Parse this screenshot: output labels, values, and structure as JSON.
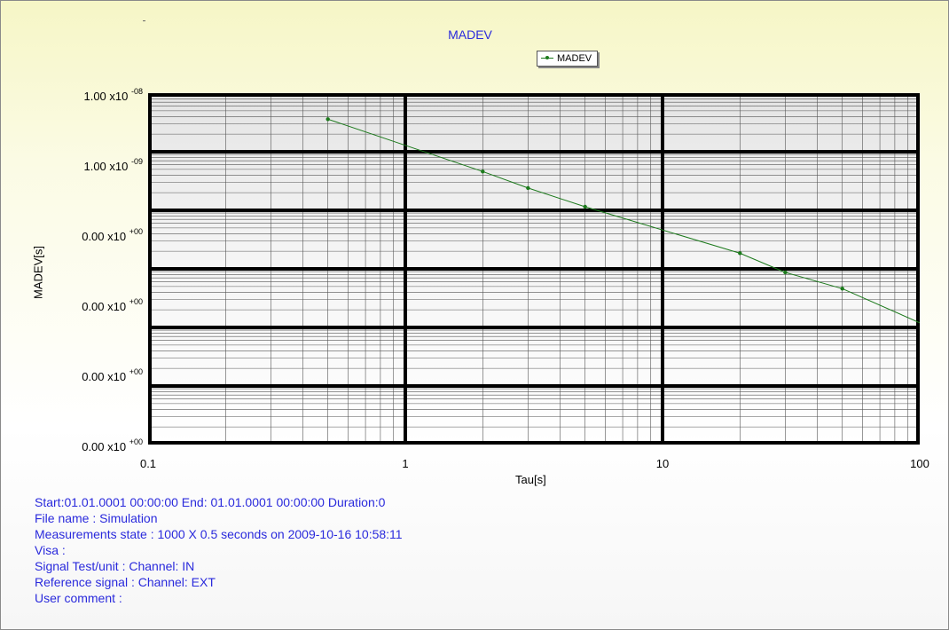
{
  "chart_data": {
    "type": "line",
    "title": "MADEV",
    "xlabel": "Tau[s]",
    "ylabel": "MADEV[s]",
    "x_scale": "log",
    "xlim": [
      0.1,
      100
    ],
    "x_ticks": [
      "0.1",
      "1",
      "10",
      "100"
    ],
    "y_scale": "log",
    "y_tick_labels": [
      {
        "mantissa": "1.00 x10",
        "exp": "-08"
      },
      {
        "mantissa": "1.00 x10",
        "exp": "-09"
      },
      {
        "mantissa": "0.00 x10",
        "exp": "+00"
      },
      {
        "mantissa": "0.00 x10",
        "exp": "+00"
      },
      {
        "mantissa": "0.00 x10",
        "exp": "+00"
      },
      {
        "mantissa": "0.00 x10",
        "exp": "+00"
      }
    ],
    "ylim": [
      1e-14,
      1e-08
    ],
    "grid": true,
    "legend_placement": "top-center",
    "series": [
      {
        "name": "MADEV",
        "color": "#1c7a1c",
        "x": [
          0.5,
          2,
          3,
          5,
          20,
          30,
          50,
          100
        ],
        "y": [
          3.6e-09,
          4.6e-10,
          2.4e-10,
          1.15e-10,
          1.85e-11,
          8.7e-12,
          4.6e-12,
          1.2e-12
        ]
      }
    ]
  },
  "info": {
    "lines": [
      "Start:01.01.0001 00:00:00 End: 01.01.0001 00:00:00 Duration:0",
      "File name : Simulation",
      "Measurements state : 1000 X 0.5 seconds on 2009-10-16 10:58:11",
      "Visa :",
      "Signal Test/unit : Channel: IN",
      "Reference signal : Channel: EXT",
      "User comment :"
    ]
  }
}
